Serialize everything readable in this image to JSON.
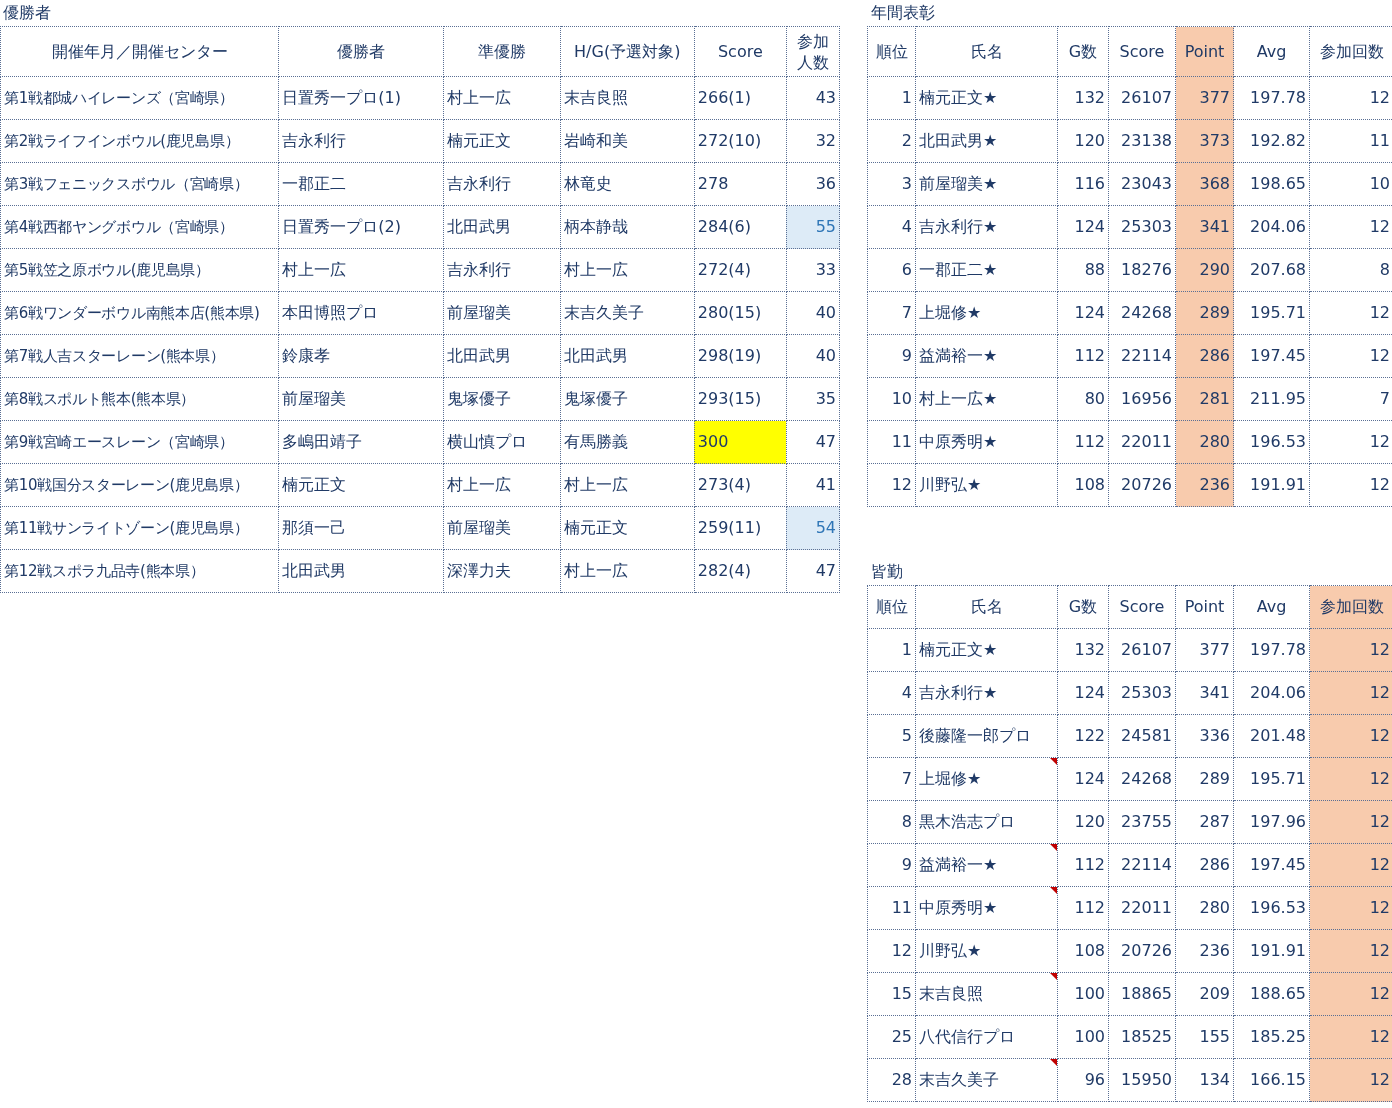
{
  "winners": {
    "title": "優勝者",
    "columns": [
      "開催年月／開催センター",
      "優勝者",
      "準優勝",
      "H/G(予選対象)",
      "Score",
      "参加人数"
    ],
    "rows": [
      {
        "cells": [
          "第1戦都城ハイレーンズ（宮崎県）",
          "日置秀一プロ(1)",
          "村上一広",
          "末吉良照",
          "266(1)",
          "43"
        ],
        "score_highlight": false,
        "count_highlight": false
      },
      {
        "cells": [
          "第2戦ライフインボウル(鹿児島県）",
          "吉永利行",
          "楠元正文",
          "岩崎和美",
          "272(10)",
          "32"
        ],
        "score_highlight": false,
        "count_highlight": false
      },
      {
        "cells": [
          "第3戦フェニックスボウル（宮崎県）",
          "一郡正二",
          "吉永利行",
          "林竜史",
          "278",
          "36"
        ],
        "score_highlight": false,
        "count_highlight": false
      },
      {
        "cells": [
          "第4戦西都ヤングボウル（宮崎県）",
          "日置秀一プロ(2)",
          "北田武男",
          "柄本静哉",
          "284(6)",
          "55"
        ],
        "score_highlight": false,
        "count_highlight": true
      },
      {
        "cells": [
          "第5戦笠之原ボウル(鹿児島県）",
          "村上一広",
          "吉永利行",
          "村上一広",
          "272(4)",
          "33"
        ],
        "score_highlight": false,
        "count_highlight": false
      },
      {
        "cells": [
          "第6戦ワンダーボウル南熊本店(熊本県)",
          "本田博照プロ",
          "前屋瑠美",
          "末吉久美子",
          "280(15)",
          "40"
        ],
        "score_highlight": false,
        "count_highlight": false
      },
      {
        "cells": [
          "第7戦人吉スターレーン(熊本県）",
          "鈴康孝",
          "北田武男",
          "北田武男",
          "298(19)",
          "40"
        ],
        "score_highlight": false,
        "count_highlight": false
      },
      {
        "cells": [
          "第8戦スポルト熊本(熊本県）",
          "前屋瑠美",
          "鬼塚優子",
          "鬼塚優子",
          "293(15)",
          "35"
        ],
        "score_highlight": false,
        "count_highlight": false
      },
      {
        "cells": [
          "第9戦宮崎エースレーン（宮崎県）",
          "多嶋田靖子",
          "横山慎プロ",
          "有馬勝義",
          "300",
          "47"
        ],
        "score_highlight": true,
        "count_highlight": false
      },
      {
        "cells": [
          "第10戦国分スターレーン(鹿児島県）",
          "楠元正文",
          "村上一広",
          "村上一広",
          "273(4)",
          "41"
        ],
        "score_highlight": false,
        "count_highlight": false
      },
      {
        "cells": [
          "第11戦サンライトゾーン(鹿児島県）",
          "那須一己",
          "前屋瑠美",
          "楠元正文",
          "259(11)",
          "54"
        ],
        "score_highlight": false,
        "count_highlight": true
      },
      {
        "cells": [
          "第12戦スポラ九品寺(熊本県）",
          "北田武男",
          "深澤力夫",
          "村上一広",
          "282(4)",
          "47"
        ],
        "score_highlight": false,
        "count_highlight": false
      }
    ]
  },
  "annual": {
    "title": "年間表彰",
    "columns": [
      {
        "label": "順位",
        "highlighted": false
      },
      {
        "label": "氏名",
        "highlighted": false
      },
      {
        "label": "G数",
        "highlighted": false
      },
      {
        "label": "Score",
        "highlighted": false
      },
      {
        "label": "Point",
        "highlighted": true
      },
      {
        "label": "Avg",
        "highlighted": false
      },
      {
        "label": "参加回数",
        "highlighted": false
      }
    ],
    "rows": [
      {
        "cells": [
          "1",
          "楠元正文★",
          "132",
          "26107",
          "377",
          "197.78",
          "12"
        ],
        "comment": false
      },
      {
        "cells": [
          "2",
          "北田武男★",
          "120",
          "23138",
          "373",
          "192.82",
          "11"
        ],
        "comment": false
      },
      {
        "cells": [
          "3",
          "前屋瑠美★",
          "116",
          "23043",
          "368",
          "198.65",
          "10"
        ],
        "comment": false
      },
      {
        "cells": [
          "4",
          "吉永利行★",
          "124",
          "25303",
          "341",
          "204.06",
          "12"
        ],
        "comment": false
      },
      {
        "cells": [
          "6",
          "一郡正二★",
          "88",
          "18276",
          "290",
          "207.68",
          "8"
        ],
        "comment": false
      },
      {
        "cells": [
          "7",
          "上堀修★",
          "124",
          "24268",
          "289",
          "195.71",
          "12"
        ],
        "comment": false
      },
      {
        "cells": [
          "9",
          "益満裕一★",
          "112",
          "22114",
          "286",
          "197.45",
          "12"
        ],
        "comment": false
      },
      {
        "cells": [
          "10",
          "村上一広★",
          "80",
          "16956",
          "281",
          "211.95",
          "7"
        ],
        "comment": false
      },
      {
        "cells": [
          "11",
          "中原秀明★",
          "112",
          "22011",
          "280",
          "196.53",
          "12"
        ],
        "comment": false
      },
      {
        "cells": [
          "12",
          "川野弘★",
          "108",
          "20726",
          "236",
          "191.91",
          "12"
        ],
        "comment": false
      }
    ]
  },
  "perfect_attendance": {
    "title": "皆勤",
    "columns": [
      {
        "label": "順位",
        "highlighted": false
      },
      {
        "label": "氏名",
        "highlighted": false
      },
      {
        "label": "G数",
        "highlighted": false
      },
      {
        "label": "Score",
        "highlighted": false
      },
      {
        "label": "Point",
        "highlighted": false
      },
      {
        "label": "Avg",
        "highlighted": false
      },
      {
        "label": "参加回数",
        "highlighted": true
      }
    ],
    "rows": [
      {
        "cells": [
          "1",
          "楠元正文★",
          "132",
          "26107",
          "377",
          "197.78",
          "12"
        ],
        "comment": false
      },
      {
        "cells": [
          "4",
          "吉永利行★",
          "124",
          "25303",
          "341",
          "204.06",
          "12"
        ],
        "comment": false
      },
      {
        "cells": [
          "5",
          "後藤隆一郎プロ",
          "122",
          "24581",
          "336",
          "201.48",
          "12"
        ],
        "comment": false
      },
      {
        "cells": [
          "7",
          "上堀修★",
          "124",
          "24268",
          "289",
          "195.71",
          "12"
        ],
        "comment": true
      },
      {
        "cells": [
          "8",
          "黒木浩志プロ",
          "120",
          "23755",
          "287",
          "197.96",
          "12"
        ],
        "comment": false
      },
      {
        "cells": [
          "9",
          "益満裕一★",
          "112",
          "22114",
          "286",
          "197.45",
          "12"
        ],
        "comment": true
      },
      {
        "cells": [
          "11",
          "中原秀明★",
          "112",
          "22011",
          "280",
          "196.53",
          "12"
        ],
        "comment": true
      },
      {
        "cells": [
          "12",
          "川野弘★",
          "108",
          "20726",
          "236",
          "191.91",
          "12"
        ],
        "comment": false
      },
      {
        "cells": [
          "15",
          "末吉良照",
          "100",
          "18865",
          "209",
          "188.65",
          "12"
        ],
        "comment": true
      },
      {
        "cells": [
          "25",
          "八代信行プロ",
          "100",
          "18525",
          "155",
          "185.25",
          "12"
        ],
        "comment": false
      },
      {
        "cells": [
          "28",
          "末吉久美子",
          "96",
          "15950",
          "134",
          "166.15",
          "12"
        ],
        "comment": true
      }
    ]
  }
}
